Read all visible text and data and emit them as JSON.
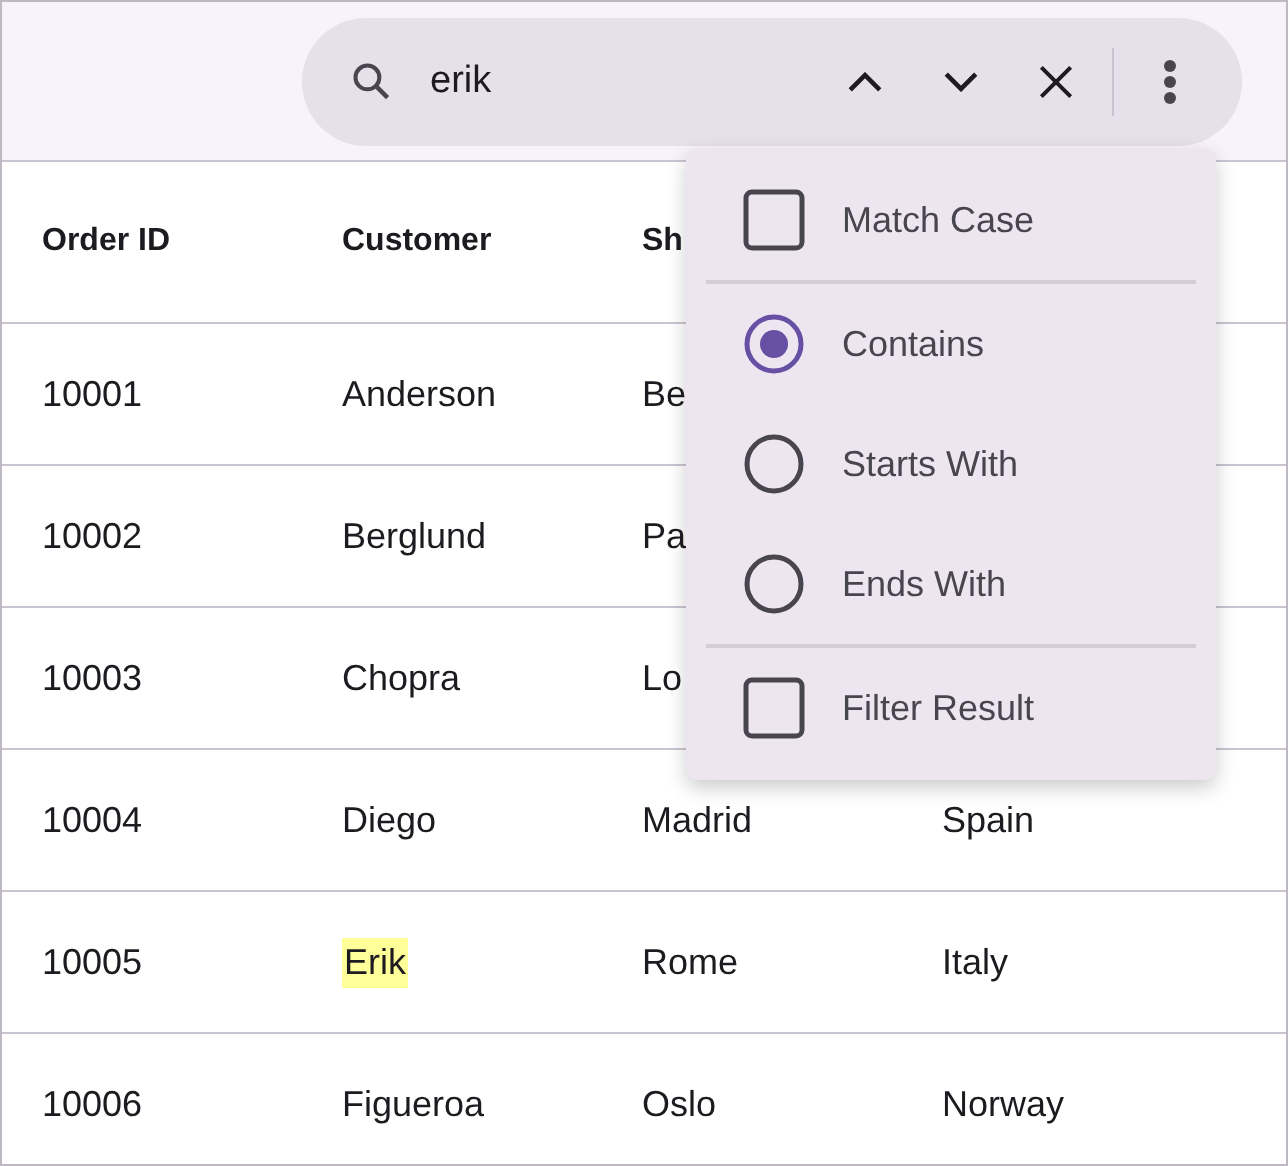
{
  "search": {
    "value": "erik"
  },
  "table": {
    "columns": [
      "Order ID",
      "Customer",
      "Sh"
    ],
    "rows": [
      {
        "cells": [
          {
            "text": "10001",
            "highlighted": false
          },
          {
            "text": "Anderson",
            "highlighted": false
          },
          {
            "text": "Be",
            "highlighted": false
          }
        ]
      },
      {
        "cells": [
          {
            "text": "10002",
            "highlighted": false
          },
          {
            "text": "Berglund",
            "highlighted": false
          },
          {
            "text": "Pa",
            "highlighted": false
          }
        ]
      },
      {
        "cells": [
          {
            "text": "10003",
            "highlighted": false
          },
          {
            "text": "Chopra",
            "highlighted": false
          },
          {
            "text": "Lo",
            "highlighted": false
          }
        ]
      },
      {
        "cells": [
          {
            "text": "10004",
            "highlighted": false
          },
          {
            "text": "Diego",
            "highlighted": false
          },
          {
            "text": "Madrid",
            "highlighted": false
          },
          {
            "text": "Spain",
            "highlighted": false
          }
        ]
      },
      {
        "cells": [
          {
            "text": "10005",
            "highlighted": false
          },
          {
            "text": "Erik",
            "highlighted": true
          },
          {
            "text": "Rome",
            "highlighted": false
          },
          {
            "text": "Italy",
            "highlighted": false
          }
        ]
      },
      {
        "cells": [
          {
            "text": "10006",
            "highlighted": false
          },
          {
            "text": "Figueroa",
            "highlighted": false
          },
          {
            "text": "Oslo",
            "highlighted": false
          },
          {
            "text": "Norway",
            "highlighted": false
          }
        ]
      }
    ]
  },
  "menu": {
    "items": [
      {
        "kind": "checkbox",
        "label": "Match Case",
        "checked": false
      },
      {
        "kind": "divider"
      },
      {
        "kind": "radio",
        "label": "Contains",
        "selected": true
      },
      {
        "kind": "radio",
        "label": "Starts With",
        "selected": false
      },
      {
        "kind": "radio",
        "label": "Ends With",
        "selected": false
      },
      {
        "kind": "divider"
      },
      {
        "kind": "checkbox",
        "label": "Filter Result",
        "checked": false
      }
    ]
  }
}
